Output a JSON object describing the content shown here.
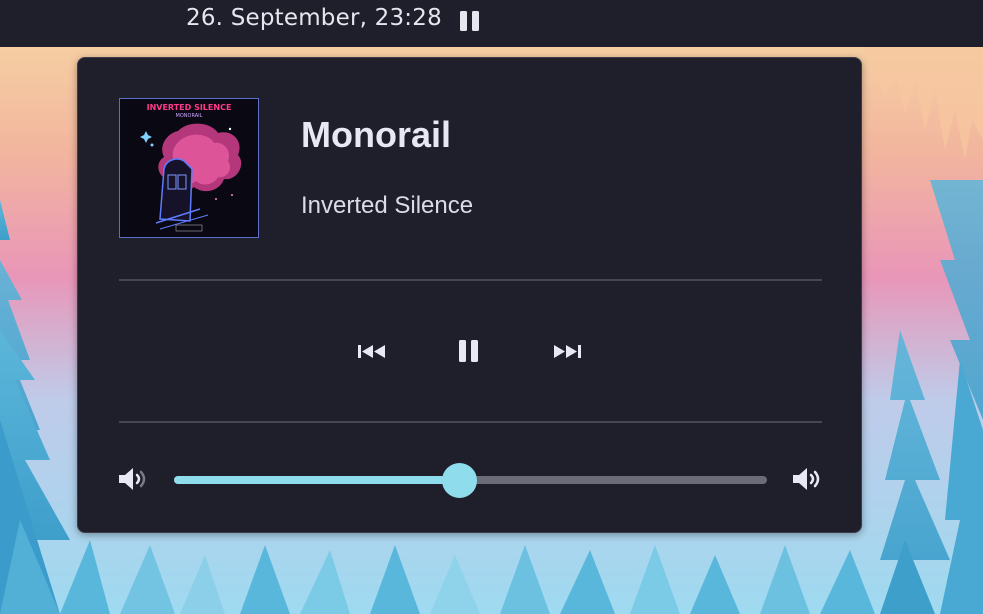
{
  "topbar": {
    "clock": "26. September, 23:28",
    "pause_icon": "pause-icon"
  },
  "media": {
    "album_art": {
      "line1": "INVERTED SILENCE",
      "line2": "MONORAIL"
    },
    "title": "Monorail",
    "artist": "Inverted Silence"
  },
  "controls": {
    "previous_icon": "skip-previous-icon",
    "play_pause_icon": "pause-icon",
    "next_icon": "skip-next-icon"
  },
  "volume": {
    "level_percent": 48,
    "low_icon": "volume-low-icon",
    "high_icon": "volume-high-icon"
  },
  "colors": {
    "panel": "#1f1f2c",
    "accent": "#8fdcec",
    "track": "#6c6c78",
    "text": "#e8e8f5"
  }
}
